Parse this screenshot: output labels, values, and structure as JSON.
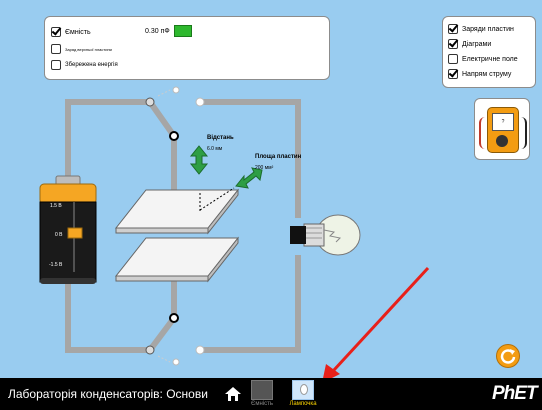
{
  "app": {
    "title": "Лабораторія конденсаторів: Основи",
    "brand": "PhET"
  },
  "left_panel": {
    "items": [
      {
        "label": "Ємність",
        "checked": true
      },
      {
        "label": "Заряд верхньої пластини",
        "checked": false
      },
      {
        "label": "Збережена енергія",
        "checked": false
      }
    ],
    "capacitance_value": "0.30 пФ",
    "capacitance_color": "#2eb82e"
  },
  "right_panel": {
    "items": [
      {
        "label": "Заряди пластин",
        "checked": true
      },
      {
        "label": "Діаграми",
        "checked": true
      },
      {
        "label": "Електричне поле",
        "checked": false
      },
      {
        "label": "Напрям струму",
        "checked": true
      }
    ]
  },
  "circuit": {
    "separation_label": "Відстань",
    "separation_value": "6.0 мм",
    "area_label": "Площа пластин",
    "area_value": "200 мм²",
    "battery_labels": [
      "1.5 В",
      "0 В",
      "-1.5 В"
    ],
    "voltmeter_reading": "?"
  },
  "nav": {
    "tabs": [
      {
        "label": "Ємність",
        "selected": false
      },
      {
        "label": "Лампочка",
        "selected": true
      }
    ]
  },
  "colors": {
    "sim_background": "#99ccf0",
    "wire": "#a6a6a6",
    "nav_background": "#000000",
    "selected_tab_text": "#ffd700",
    "reset_button": "#f39c12",
    "arrow_annotation": "#e8201a",
    "drag_arrow": "#2e9e44",
    "battery_body": "#f5a623"
  },
  "icons": [
    "home-icon",
    "reset-icon",
    "capacitor-tab-icon",
    "lightbulb-tab-icon",
    "voltmeter-icon",
    "phet-logo"
  ]
}
